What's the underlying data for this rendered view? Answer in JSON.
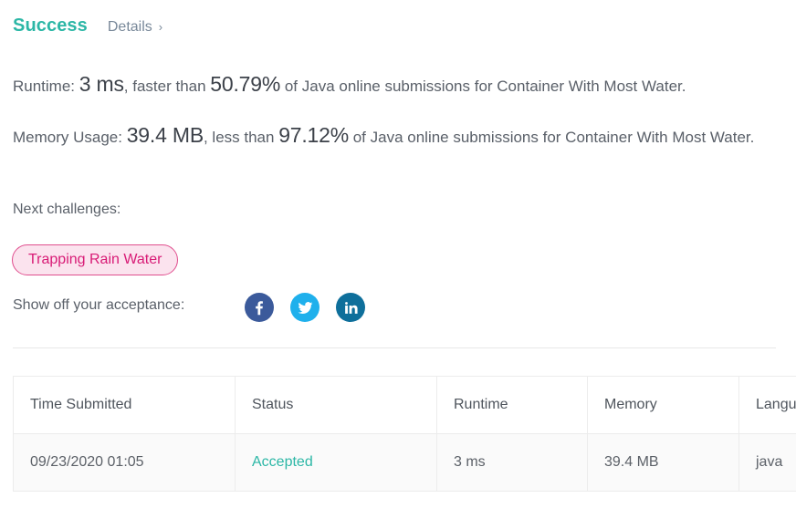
{
  "header": {
    "status": "Success",
    "details_label": "Details",
    "chevron": "›",
    "status_color": "#2cb7a6"
  },
  "stats": {
    "runtime": {
      "prefix": "Runtime: ",
      "value": "3 ms",
      "middle": ", faster than ",
      "percentile": "50.79%",
      "suffix": " of Java online submissions for Container With Most Water."
    },
    "memory": {
      "prefix": "Memory Usage: ",
      "value": "39.4 MB",
      "middle": ", less than ",
      "percentile": "97.12%",
      "suffix": " of Java online submissions for Container With Most Water."
    }
  },
  "next_challenges": {
    "label": "Next challenges:",
    "tags": [
      {
        "label": "Trapping Rain Water",
        "bg": "#fbe3ee",
        "border": "#e04e8e",
        "color": "#d81b76"
      }
    ]
  },
  "share": {
    "label": "Show off your acceptance:",
    "buttons": [
      {
        "name": "facebook-icon",
        "color": "#3b5a9b"
      },
      {
        "name": "twitter-icon",
        "color": "#1fb0ec"
      },
      {
        "name": "linkedin-icon",
        "color": "#0e6f9b"
      }
    ]
  },
  "submissions_table": {
    "columns": [
      "Time Submitted",
      "Status",
      "Runtime",
      "Memory",
      "Language"
    ],
    "rows": [
      {
        "time_submitted": "09/23/2020 01:05",
        "status": "Accepted",
        "runtime": "3 ms",
        "memory": "39.4 MB",
        "language": "java"
      }
    ]
  }
}
